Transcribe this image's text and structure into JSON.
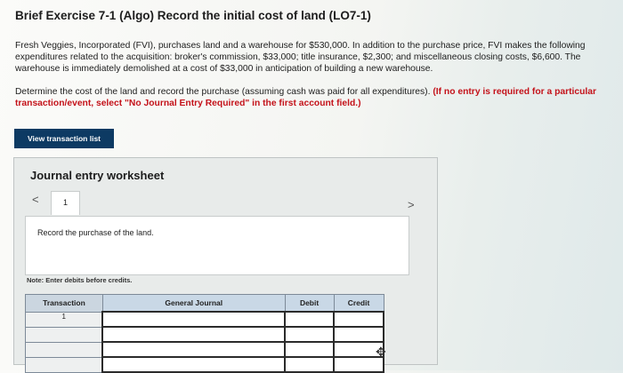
{
  "title": "Brief Exercise 7-1 (Algo) Record the initial cost of land (LO7-1)",
  "paragraph1": "Fresh Veggies, Incorporated (FVI), purchases land and a warehouse for $530,000. In addition to the purchase price, FVI makes the following expenditures related to the acquisition: broker's commission, $33,000; title insurance, $2,300; and miscellaneous closing costs, $6,600. The warehouse is immediately demolished at a cost of $33,000 in anticipation of building a new warehouse.",
  "paragraph2_plain": "Determine the cost of the land and record the purchase (assuming cash was paid for all expenditures). ",
  "paragraph2_bold": "(If no entry is required for a particular transaction/event, select \"No Journal Entry Required\" in the first account field.)",
  "view_button": "View transaction list",
  "worksheet": {
    "title": "Journal entry worksheet",
    "nav_prev": "<",
    "nav_next": ">",
    "tab": "1",
    "instruction": "Record the purchase of the land.",
    "note": "Note: Enter debits before credits."
  },
  "table": {
    "headers": [
      "Transaction",
      "General Journal",
      "Debit",
      "Credit"
    ],
    "rows": [
      {
        "transaction": "1"
      },
      {
        "transaction": ""
      },
      {
        "transaction": ""
      },
      {
        "transaction": ""
      }
    ]
  }
}
